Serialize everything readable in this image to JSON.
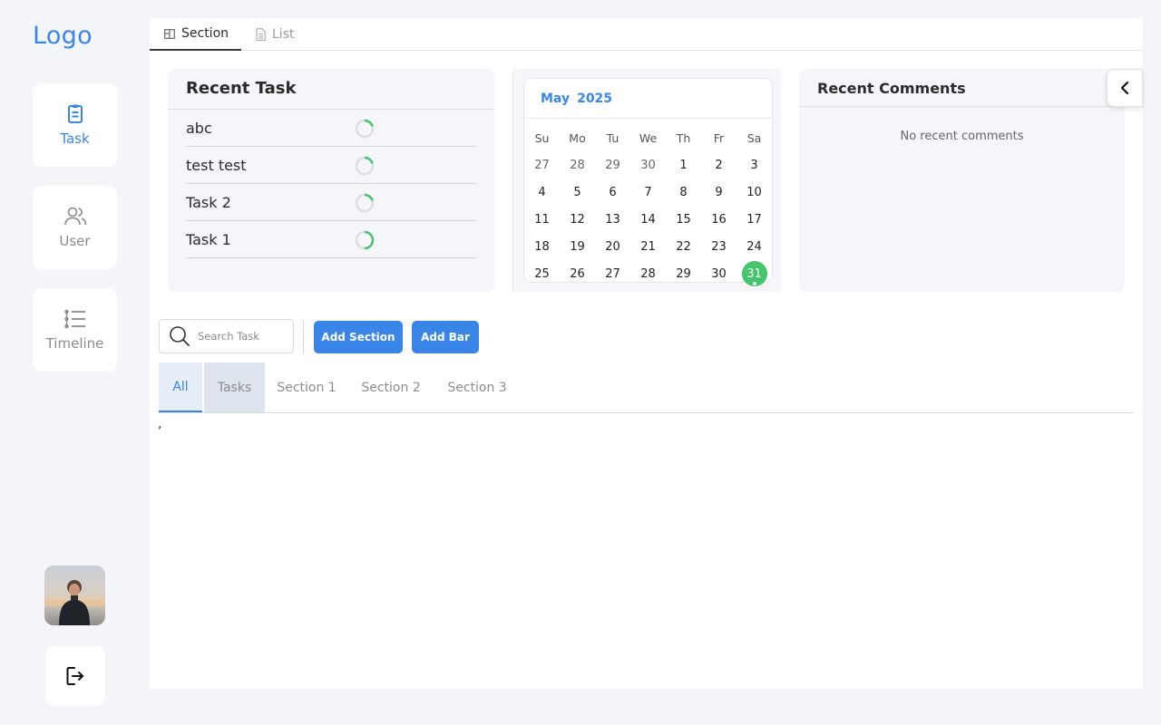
{
  "sidebar": {
    "logo": "Logo",
    "items": [
      {
        "label": "Task",
        "icon": "clipboard-icon",
        "active": true
      },
      {
        "label": "User",
        "icon": "users-icon",
        "active": false
      },
      {
        "label": "Timeline",
        "icon": "list-icon",
        "active": false
      }
    ],
    "logout_icon": "logout-icon"
  },
  "view_tabs": [
    {
      "label": "Section",
      "icon": "board-icon",
      "active": true
    },
    {
      "label": "List",
      "icon": "document-icon",
      "active": false
    }
  ],
  "recent_tasks": {
    "title": "Recent Task",
    "items": [
      {
        "name": "abc",
        "progress": 0.2
      },
      {
        "name": "test test",
        "progress": 0.2
      },
      {
        "name": "Task 2",
        "progress": 0.2
      },
      {
        "name": "Task 1",
        "progress": 0.5
      }
    ]
  },
  "calendar": {
    "month": "May",
    "year": "2025",
    "weekdays": [
      "Su",
      "Mo",
      "Tu",
      "We",
      "Th",
      "Fr",
      "Sa"
    ],
    "weeks": [
      [
        "27",
        "28",
        "29",
        "30",
        "1",
        "2",
        "3"
      ],
      [
        "4",
        "5",
        "6",
        "7",
        "8",
        "9",
        "10"
      ],
      [
        "11",
        "12",
        "13",
        "14",
        "15",
        "16",
        "17"
      ],
      [
        "18",
        "19",
        "20",
        "21",
        "22",
        "23",
        "24"
      ],
      [
        "25",
        "26",
        "27",
        "28",
        "29",
        "30",
        "31"
      ]
    ],
    "today": "31",
    "today_color": "#45c46b"
  },
  "recent_comments": {
    "title": "Recent Comments",
    "empty_text": "No recent comments"
  },
  "toolbar": {
    "search_placeholder": "Search Task",
    "add_section_label": "Add Section",
    "add_bar_label": "Add Bar"
  },
  "section_tabs": [
    {
      "label": "All",
      "active": true
    },
    {
      "label": "Tasks",
      "active": false
    },
    {
      "label": "Section 1",
      "active": false
    },
    {
      "label": "Section 2",
      "active": false
    },
    {
      "label": "Section 3",
      "active": false
    }
  ],
  "content_text": ",",
  "colors": {
    "accent": "#3a86e8",
    "progress": "#45c46b"
  }
}
